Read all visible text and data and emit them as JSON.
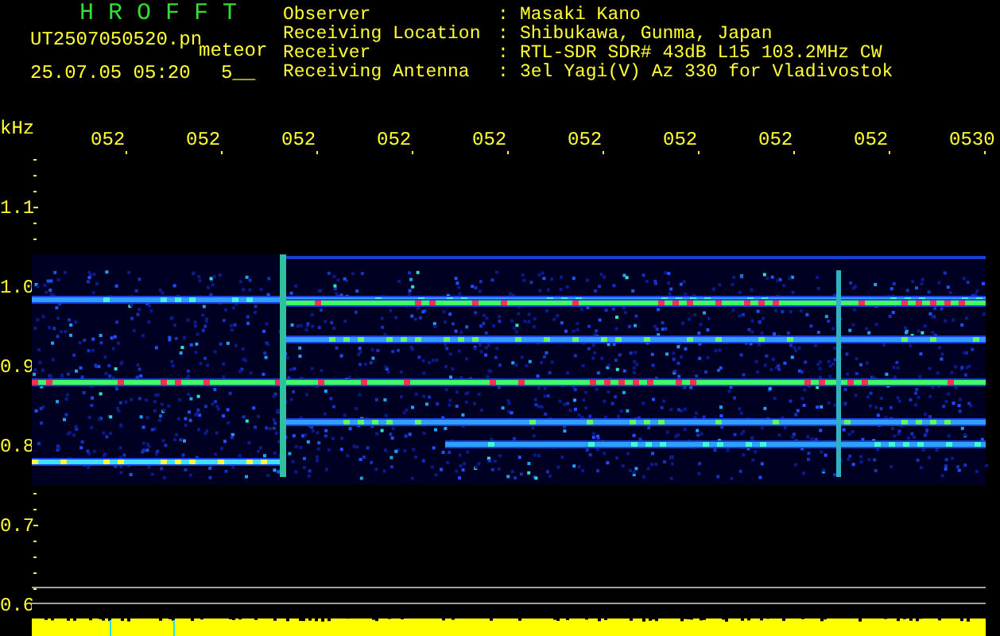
{
  "header": {
    "title": "H R O F F T",
    "file_name": "UT2507050520.pn",
    "file_tag": "meteor",
    "timestamp": "25.07.05 05:20",
    "count": "5__"
  },
  "station_info": [
    {
      "label": "Observer",
      "separator": ":",
      "value": "Masaki Kano"
    },
    {
      "label": "Receiving Location",
      "separator": ":",
      "value": "Shibukawa, Gunma, Japan"
    },
    {
      "label": "Receiver",
      "separator": ":",
      "value": "RTL-SDR SDR# 43dB L15 103.2MHz CW"
    },
    {
      "label": "Receiving Antenna",
      "separator": ":",
      "value": "3el Yagi(V) Az 330 for Vladivostok"
    }
  ],
  "spectrogram": {
    "y_unit": "kHz",
    "time_labels": [
      "052",
      "052",
      "052",
      "052",
      "052",
      "052",
      "052",
      "052",
      "052",
      "0530"
    ],
    "y_labels": [
      "1.1",
      "1.0",
      "0.9",
      "0.8",
      "0.7",
      "0.6"
    ]
  }
}
